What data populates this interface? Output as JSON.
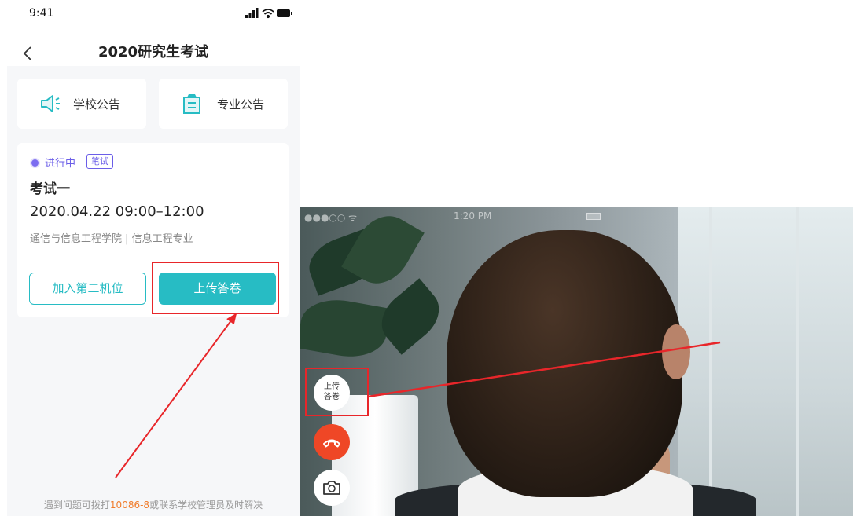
{
  "phone": {
    "status_time": "9:41",
    "title": "2020研究生考试",
    "notices": [
      {
        "label": "学校公告",
        "icon": "speaker-icon"
      },
      {
        "label": "专业公告",
        "icon": "clipboard-icon"
      }
    ],
    "exam": {
      "status": "进行中",
      "type_badge": "笔试",
      "name": "考试一",
      "time": "2020.04.22  09:00–12:00",
      "org": "通信与信息工程学院 | 信息工程专业",
      "second_device_label": "加入第二机位",
      "upload_label": "上传答卷"
    },
    "footer": {
      "prefix": "遇到问题可拨打",
      "phone": "10086-8",
      "suffix": "或联系学校管理员及时解决"
    }
  },
  "video_call": {
    "status_signal": "●●●○○ ᯤ",
    "status_time": "1:20 PM",
    "upload_button_line1": "上传",
    "upload_button_line2": "答卷",
    "hangup_icon": "hang-up-icon",
    "camera_icon": "switch-camera-icon"
  },
  "colors": {
    "accent": "#27bcc4",
    "status_purple": "#6b5ee8",
    "highlight_red": "#e8262a",
    "hangup_red": "#ef4726",
    "phone_orange": "#f07c2b"
  }
}
